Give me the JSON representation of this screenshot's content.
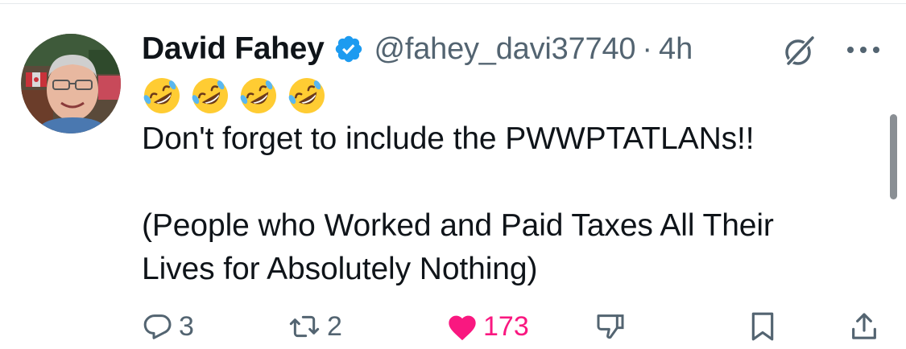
{
  "tweet": {
    "author": {
      "display_name": "David Fahey",
      "handle": "@fahey_davi37740",
      "verified": true,
      "avatar": "profile-photo"
    },
    "separator": "·",
    "time": "4h",
    "emojis": [
      "rolling-on-floor-laughing",
      "rolling-on-floor-laughing",
      "rolling-on-floor-laughing",
      "rolling-on-floor-laughing"
    ],
    "text_lines": [
      "Don't forget to include the PWWPTATLANs!!",
      "",
      "(People who Worked and Paid Taxes All Their",
      "Lives for Absolutely Nothing)"
    ],
    "actions": {
      "replies": "3",
      "reposts": "2",
      "likes": "173",
      "liked": true
    }
  },
  "icons": {
    "reply": "speech-bubble-icon",
    "repost": "repost-arrows-icon",
    "like": "heart-icon",
    "downvote": "thumbs-down-icon",
    "bookmark": "bookmark-icon",
    "share": "share-upload-icon",
    "grok": "grok-slash-circle-icon",
    "more": "three-dots-icon"
  },
  "colors": {
    "text": "#0f1419",
    "secondary": "#536471",
    "verified": "#1d9bf0",
    "like": "#f91880"
  }
}
